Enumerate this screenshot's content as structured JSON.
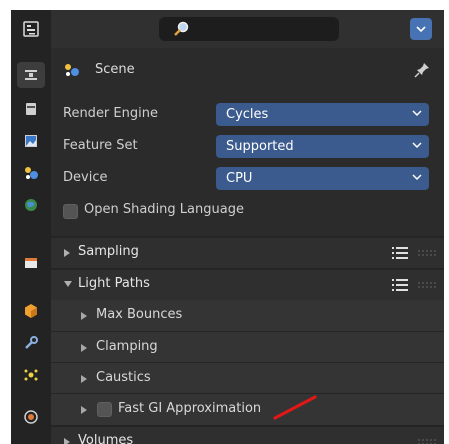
{
  "scene": {
    "name": "Scene"
  },
  "render_panel": {
    "properties": [
      {
        "label": "Render Engine",
        "value": "Cycles"
      },
      {
        "label": "Feature Set",
        "value": "Supported"
      },
      {
        "label": "Device",
        "value": "CPU"
      }
    ],
    "osl_checkbox": {
      "label": "Open Shading Language",
      "checked": false
    }
  },
  "sections": {
    "sampling": {
      "label": "Sampling",
      "expanded": false
    },
    "light_paths": {
      "label": "Light Paths",
      "expanded": true,
      "subpanels": [
        {
          "label": "Max Bounces"
        },
        {
          "label": "Clamping"
        },
        {
          "label": "Caustics"
        }
      ],
      "fast_gi": {
        "label": "Fast GI Approximation",
        "checked": false
      }
    },
    "volumes": {
      "label": "Volumes",
      "expanded": false
    }
  },
  "colors": {
    "accent": "#4772b3",
    "dropdown": "#3b5a8d",
    "annotation": "#e01818"
  },
  "icons": {
    "editor_type": "properties-editor-icon",
    "search": "search-icon",
    "menu": "chevron-down-icon",
    "pin": "pin-icon",
    "tabs": [
      "tool-icon",
      "render-icon",
      "output-icon",
      "view-layer-icon",
      "scene-icon",
      "world-icon",
      "collection-icon",
      "object-icon",
      "modifier-icon",
      "particles-icon",
      "physics-icon"
    ]
  }
}
